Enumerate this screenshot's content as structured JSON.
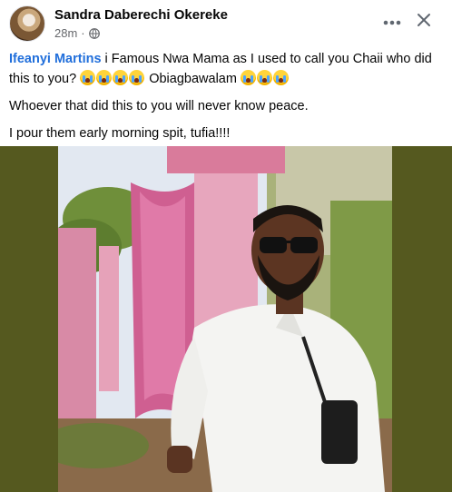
{
  "post": {
    "author": "Sandra Daberechi Okereke",
    "time": "28m",
    "separator": "·",
    "audience_icon": "globe-icon",
    "more_icon": "more-horizontal-icon",
    "close_icon": "close-icon"
  },
  "caption": {
    "mention": "Ifeanyi Martins",
    "line1_text": " i Famous Nwa Mama as I used to call you Chaii who did this to you? ",
    "line1_suffix": " Obiagbawalam ",
    "emoji_name": "loudly-crying-face",
    "line2": "Whoever that did this to you will never know peace.",
    "line3": "I pour them early morning spit, tufia!!!!"
  },
  "media": {
    "description_background": "#55591f",
    "photo_alt": "Man in white attire and sunglasses standing under pink decorations"
  }
}
